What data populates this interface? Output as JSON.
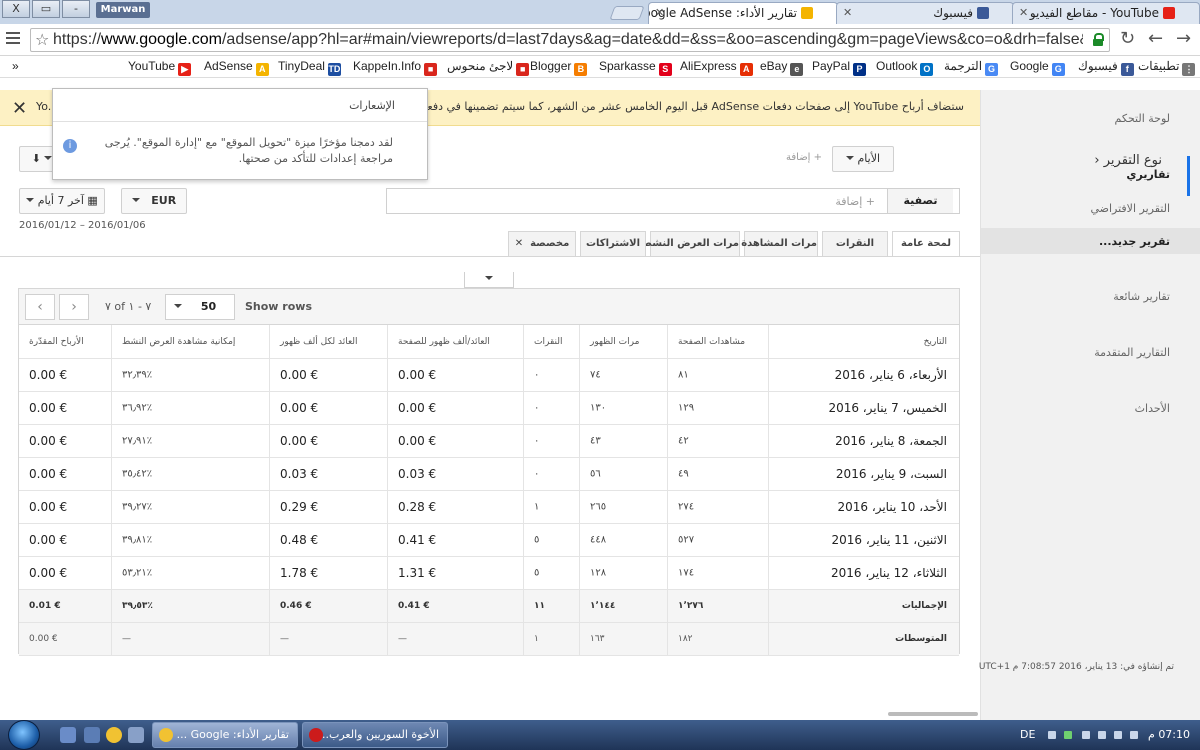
{
  "window": {
    "profile": "Marwan",
    "min_label": "-",
    "max_label": "▭",
    "close_label": "X",
    "tabs": [
      {
        "title": "تقارير الأداء: Google AdSense",
        "active": true
      },
      {
        "title": "فيسبوك",
        "active": false
      },
      {
        "title": "YouTube - مقاطع الفيديو",
        "active": false
      }
    ]
  },
  "address": {
    "url_prefix": "https://",
    "url_host": "www.google.com",
    "url_rest": "/adsense/app?hl=ar#main/viewreports/d=last7days&ag=date&dd=&ss=&oo=ascending&gm=pageViews&co=o&drh=false&ct=td8"
  },
  "bookmarks": {
    "overflow": "»",
    "overflow_right": "»",
    "items": [
      {
        "label": "YouTube",
        "color": "#e62117",
        "glyph": "▶"
      },
      {
        "label": "AdSense",
        "color": "#f4b400",
        "glyph": "A"
      },
      {
        "label": "TinyDeal",
        "color": "#1d4ea1",
        "glyph": "TD"
      },
      {
        "label": "KappeIn.Info",
        "color": "#d9261c",
        "glyph": "■"
      },
      {
        "label": "لاجئ منحوس",
        "color": "#d9261c",
        "glyph": "■"
      },
      {
        "label": "Blogger",
        "color": "#f57d00",
        "glyph": "B"
      },
      {
        "label": "Sparkasse",
        "color": "#e2001a",
        "glyph": "S"
      },
      {
        "label": "AliExpress",
        "color": "#e62e04",
        "glyph": "A"
      },
      {
        "label": "eBay",
        "color": "#555555",
        "glyph": "e"
      },
      {
        "label": "PayPal",
        "color": "#003087",
        "glyph": "P"
      },
      {
        "label": "Outlook",
        "color": "#0072c6",
        "glyph": "O"
      },
      {
        "label": "الترجمة",
        "color": "#4a8af4",
        "glyph": "G"
      },
      {
        "label": "Google",
        "color": "#4285f4",
        "glyph": "G"
      },
      {
        "label": "فيسبوك",
        "color": "#3b5998",
        "glyph": "f"
      },
      {
        "label": "تطبيقات",
        "color": "#777777",
        "glyph": "⋮"
      }
    ]
  },
  "banner": {
    "text": "ستضاف أرباح YouTube إلى صفحات دفعات AdSense قبل اليوم الخامس عشر من الشهر، كما سيتم تضمينها في دفعتك إذا كان إجم",
    "left_fragment": "Yo."
  },
  "notification": {
    "title": "الإشعارات",
    "icon": "i",
    "body": "لقد دمجنا مؤخرًا ميزة \"تحويل الموقع\" مع \"إدارة الموقع\". يُرجى مراجعة إعدادات للتأكد من صحتها."
  },
  "sidebar": {
    "dashboard": "لوحة التحكم",
    "reports": "تقاريري",
    "default_report": "التقرير الافتراضي",
    "new_report": "تقرير جديد...",
    "common_reports": "تقارير شائعة",
    "advanced_reports": "التقارير المتقدمة",
    "events": "الأحداث"
  },
  "toolbar": {
    "report_type_label": "نوع التقرير",
    "days_label": "الأيام",
    "add_label": "+ إضافة",
    "filter_label": "تصفية",
    "filter_add": "+ إضافة",
    "currency": "EUR",
    "date_preset": "آخر 7 أيام",
    "date_range": "2016/01/12 – 2016/01/06",
    "download_icon": "⬇",
    "calendar_icon": "▦"
  },
  "tabs": [
    {
      "label": "لمحة عامة",
      "active": true
    },
    {
      "label": "النقرات",
      "active": false
    },
    {
      "label": "مرات المشاهدة",
      "active": false
    },
    {
      "label": "مرات العرض النشط",
      "active": false
    },
    {
      "label": "الاشتراكات",
      "active": false
    },
    {
      "label": "مخصصة",
      "active": false,
      "close": "✕"
    }
  ],
  "table": {
    "pager_range": "٧ of ٧ - ١",
    "rows_value": "50",
    "rows_label": "Show rows",
    "prev": "‹",
    "next": "›",
    "headers": [
      "التاريخ",
      "مشاهدات الصفحة",
      "مرات الظهور",
      "النقرات",
      "العائد/ألف ظهور للصفحة",
      "العائد لكل ألف ظهور",
      "إمكانية مشاهدة العرض النشط",
      "الأرباح المقدّرة"
    ],
    "rows": [
      [
        "الأربعاء، 6 يناير، 2016",
        "٨١",
        "٧٤",
        "٠",
        "0.00 €",
        "0.00 €",
        "٣٢٫٣٩٪",
        "0.00 €"
      ],
      [
        "الخميس، 7 يناير، 2016",
        "١٢٩",
        "١٣٠",
        "٠",
        "0.00 €",
        "0.00 €",
        "٣٦٫٩٢٪",
        "0.00 €"
      ],
      [
        "الجمعة، 8 يناير، 2016",
        "٤٢",
        "٤٣",
        "٠",
        "0.00 €",
        "0.00 €",
        "٢٧٫٩١٪",
        "0.00 €"
      ],
      [
        "السبت، 9 يناير، 2016",
        "٤٩",
        "٥٦",
        "٠",
        "0.03 €",
        "0.03 €",
        "٣٥٫٤٢٪",
        "0.00 €"
      ],
      [
        "الأحد، 10 يناير، 2016",
        "٢٧٤",
        "٢٦٥",
        "١",
        "0.28 €",
        "0.29 €",
        "٣٩٫٢٧٪",
        "0.00 €"
      ],
      [
        "الاثنين، 11 يناير، 2016",
        "٥٢٧",
        "٤٤٨",
        "٥",
        "0.41 €",
        "0.48 €",
        "٣٩٫٨١٪",
        "0.00 €"
      ],
      [
        "الثلاثاء، 12 يناير، 2016",
        "١٧٤",
        "١٢٨",
        "٥",
        "1.31 €",
        "1.78 €",
        "٥٣٫٢١٪",
        "0.00 €"
      ]
    ],
    "totals": [
      "الإجماليات",
      "١٬٢٧٦",
      "١٬١٤٤",
      "١١",
      "0.41 €",
      "0.46 €",
      "٣٩٫٥٣٪",
      "0.01 €"
    ],
    "averages": [
      "المتوسطات",
      "١٨٢",
      "١٦٣",
      "١",
      "—",
      "—",
      "—",
      "0.00 €"
    ]
  },
  "generated": "تم إنشاؤه في: 13 يناير، 2016 7:08:57 م UTC+1",
  "taskbar": {
    "task1": "تقارير الأداء: Google ...",
    "task2": "الأخوة السوريين والعرب...",
    "lang": "DE",
    "time": "07:10 م"
  }
}
